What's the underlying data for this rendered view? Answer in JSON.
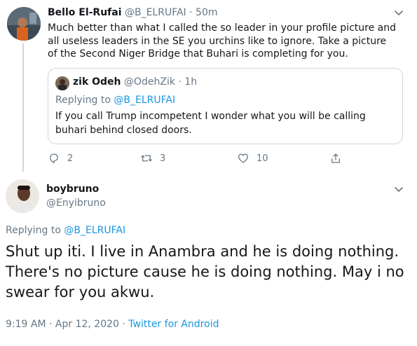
{
  "colors": {
    "link": "#1b95e0",
    "muted": "#657786",
    "border": "#ccd6dd",
    "text": "#14171a"
  },
  "tweet1": {
    "name": "Bello El-Rufai",
    "handle": "@B_ELRUFAI",
    "separator": "·",
    "time": "50m",
    "text": "Much better than what I called the so leader in your profile picture and all useless leaders in the SE you urchins like to ignore. Take a picture of the Second Niger Bridge that Buhari is completing for you.",
    "quote": {
      "name": "zik Odeh",
      "handle": "@OdehZik",
      "separator": "·",
      "time": "1h",
      "replying_prefix": "Replying to",
      "replying_user": "@B_ELRUFAI",
      "text": "If you call Trump incompetent I wonder what you will be calling buhari behind closed doors."
    },
    "actions": {
      "reply_count": "2",
      "retweet_count": "3",
      "like_count": "10",
      "icons": [
        "reply-icon",
        "retweet-icon",
        "like-icon",
        "share-icon"
      ]
    }
  },
  "tweet2": {
    "name": "boybruno",
    "handle": "@Enyibruno",
    "replying_prefix": "Replying to",
    "replying_user": "@B_ELRUFAI",
    "text": "Shut up iti. I live in Anambra and he is doing nothing. There's no picture cause he is doing nothing. May i no swear for you akwu.",
    "timestamp": "9:19 AM · Apr 12, 2020 ·",
    "source": "Twitter for Android"
  }
}
